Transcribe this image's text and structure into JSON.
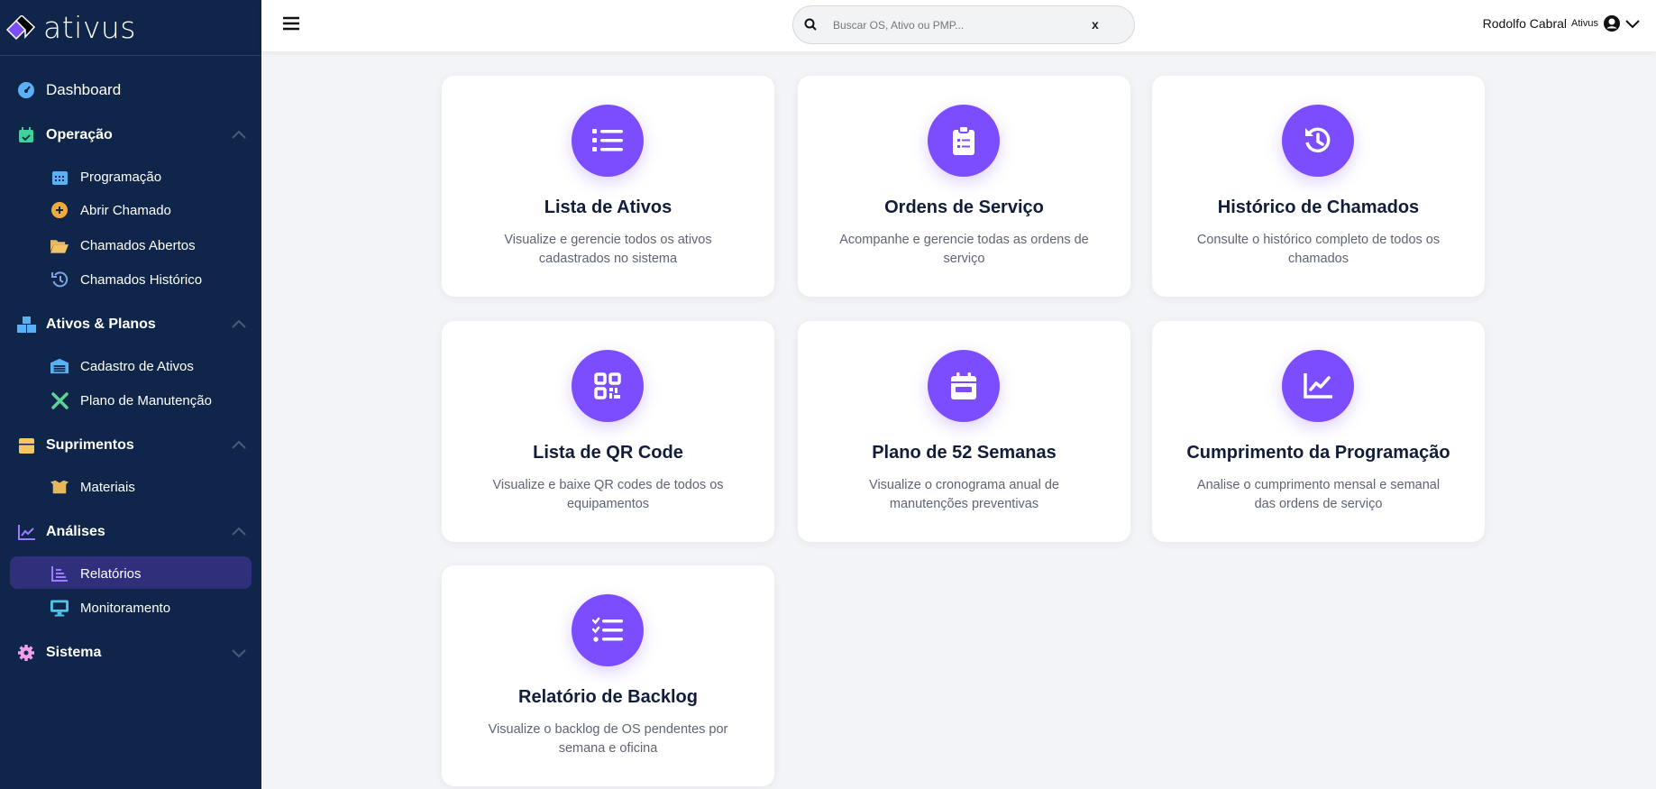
{
  "app": {
    "logo_text": "ativus"
  },
  "sidebar": {
    "dashboard": "Dashboard",
    "operacao": {
      "label": "Operação",
      "items": [
        "Programação",
        "Abrir Chamado",
        "Chamados Abertos",
        "Chamados Histórico"
      ]
    },
    "ativos": {
      "label": "Ativos & Planos",
      "items": [
        "Cadastro de Ativos",
        "Plano de Manutenção"
      ]
    },
    "suprimentos": {
      "label": "Suprimentos",
      "items": [
        "Materiais"
      ]
    },
    "analises": {
      "label": "Análises",
      "items": [
        "Relatórios",
        "Monitoramento"
      ]
    },
    "sistema": {
      "label": "Sistema"
    },
    "active_item": "Relatórios"
  },
  "topbar": {
    "search_placeholder": "Buscar OS, Ativo ou PMP...",
    "clear": "x",
    "user_name": "Rodolfo Cabral",
    "user_role": "Ativus"
  },
  "colors": {
    "sidebar": "#0f2549",
    "accent": "#7c4dff",
    "active": "#302f7c"
  },
  "cards": [
    {
      "title": "Lista de Ativos",
      "desc": "Visualize e gerencie todos os ativos cadastrados no sistema",
      "icon": "list-icon"
    },
    {
      "title": "Ordens de Serviço",
      "desc": "Acompanhe e gerencie todas as ordens de serviço",
      "icon": "clipboard-icon"
    },
    {
      "title": "Histórico de Chamados",
      "desc": "Consulte o histórico completo de todos os chamados",
      "icon": "history-icon"
    },
    {
      "title": "Lista de QR Code",
      "desc": "Visualize e baixe QR codes de todos os equipamentos",
      "icon": "qrcode-icon"
    },
    {
      "title": "Plano de 52 Semanas",
      "desc": "Visualize o cronograma anual de manutenções preventivas",
      "icon": "calendar-icon"
    },
    {
      "title": "Cumprimento da Programação",
      "desc": "Analise o cumprimento mensal e semanal das ordens de serviço",
      "icon": "chart-line-icon"
    },
    {
      "title": "Relatório de Backlog",
      "desc": "Visualize o backlog de OS pendentes por semana e oficina",
      "icon": "list-check-icon"
    }
  ]
}
